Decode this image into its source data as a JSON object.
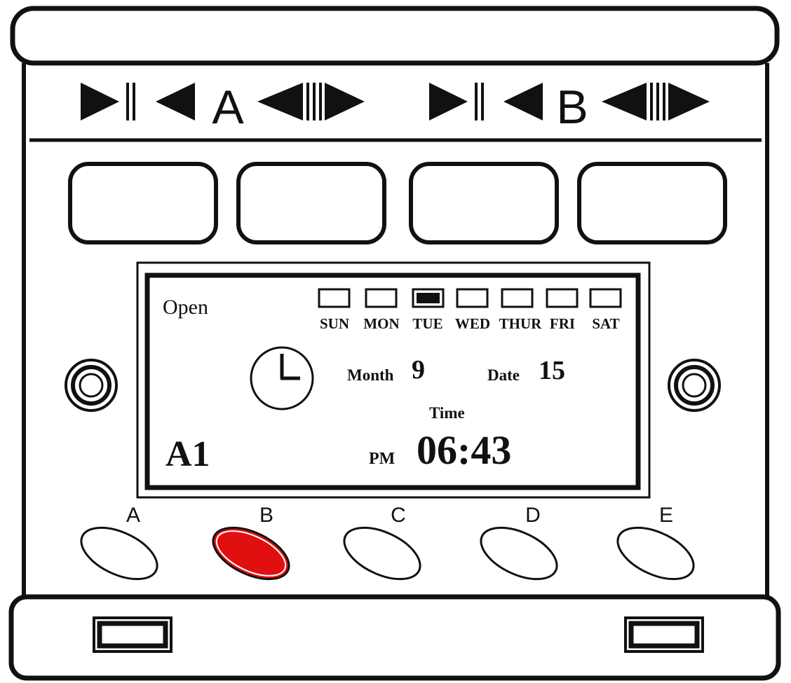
{
  "channels": {
    "a_label": "A",
    "b_label": "B"
  },
  "display": {
    "mode": "Open",
    "days": [
      {
        "label": "SUN",
        "active": false
      },
      {
        "label": "MON",
        "active": false
      },
      {
        "label": "TUE",
        "active": true
      },
      {
        "label": "WED",
        "active": false
      },
      {
        "label": "THUR",
        "active": false
      },
      {
        "label": "FRI",
        "active": false
      },
      {
        "label": "SAT",
        "active": false
      }
    ],
    "month_label": "Month",
    "month_value": "9",
    "date_label": "Date",
    "date_value": "15",
    "time_label": "Time",
    "ampm": "PM",
    "time_value": "06:43",
    "program": "A1",
    "clock_icon": "clock-icon"
  },
  "buttons": [
    {
      "label": "A",
      "pressed": false
    },
    {
      "label": "B",
      "pressed": true
    },
    {
      "label": "C",
      "pressed": false
    },
    {
      "label": "D",
      "pressed": false
    },
    {
      "label": "E",
      "pressed": false
    }
  ],
  "colors": {
    "outline": "#111111",
    "pressed_button": "#e01010",
    "active_day": "#111111"
  }
}
